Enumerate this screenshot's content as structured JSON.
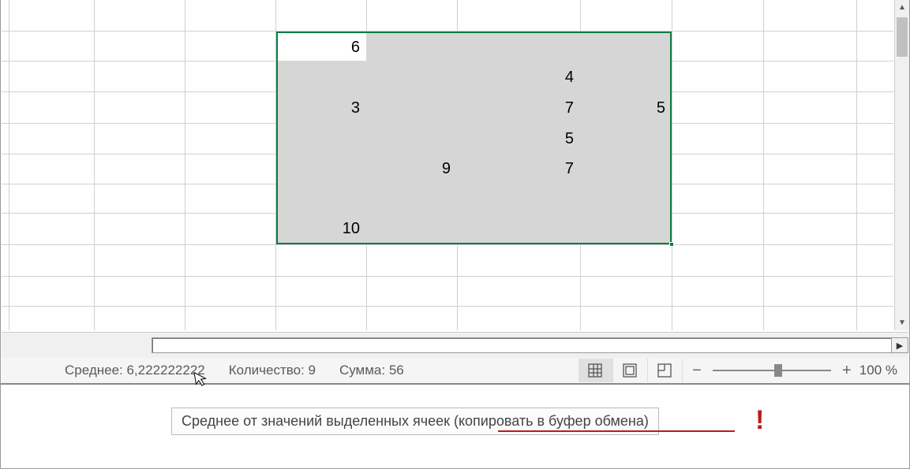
{
  "cells": {
    "r0c0": "6",
    "r1c2": "4",
    "r2c0": "3",
    "r2c2": "7",
    "r2c3": "5",
    "r3c2": "5",
    "r4c1": "9",
    "r4c2": "7",
    "r6c0": "10"
  },
  "status": {
    "avg_label": "Среднее: 6,222222222",
    "count_label": "Количество: 9",
    "sum_label": "Сумма: 56",
    "zoom_label": "100 %"
  },
  "tooltip": {
    "text": "Среднее от значений выделенных ячеек (копировать в буфер обмена)"
  },
  "annotation": {
    "excl": "!"
  }
}
